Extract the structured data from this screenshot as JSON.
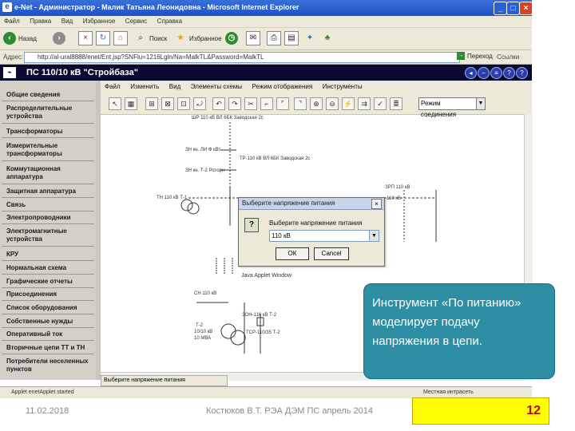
{
  "browser": {
    "title": "e-Net - Администратор - Малик Татьяна Леонидовна - Microsoft Internet Explorer",
    "menu": [
      "Файл",
      "Правка",
      "Вид",
      "Избранное",
      "Сервис",
      "Справка"
    ],
    "toolbar": {
      "back": "Назад",
      "search": "Поиск",
      "favorites": "Избранное"
    },
    "address_label": "Адрес:",
    "address": "http://al-ural8888/enet/Ent.jsp?SNFlu=1216Lgln/Na=MalkTL&Password=MalkTL",
    "go": "Переход",
    "links": "Ссылки",
    "status_left": "Applet enetApplet started",
    "status_right": "Местная интрасеть"
  },
  "app": {
    "title": "ПС 110/10 кВ \"Стройбаза\"",
    "sidebar": [
      "Общие сведения",
      "Распределительные устройства",
      "Трансформаторы",
      "Измерительные трансформаторы",
      "Коммутационная аппаратура",
      "Защитная аппаратура",
      "Связь",
      "Электропроводники",
      "Электромагнитные устройства",
      "КРУ",
      "Нормальная схема",
      "Графические отчеты",
      "Присоединения",
      "Список оборудования",
      "Собственные нужды",
      "Оперативный ток",
      "Вторичные цепи ТТ и ТН",
      "Потребители неселенных пунктов"
    ],
    "editor_menu": [
      "Файл",
      "Изменить",
      "Вид",
      "Элементы схемы",
      "Режим отображения",
      "Инструменты"
    ],
    "mode": "Режим соединения",
    "editor_status": "Выберите напряжение питания"
  },
  "dialog": {
    "title": "Выберите напряжение питания",
    "prompt": "Выберите напряжение питания",
    "value": "110 кВ",
    "ok": "ОК",
    "cancel": "Cancel",
    "java_label": "Java Applet Window"
  },
  "schematic": {
    "labels": [
      "ШР 110 кВ ВЛ 6БК Заводская 2с",
      "ЗН кн. ЛИ Ф кВт",
      "ТР-110 кВ ВЛ 6БК Заводская 2с",
      "ЗН кн. Т-2 Роторн",
      "ТН 110 кВ Т-1",
      "ЗРП 110 кВ",
      "110 кВ",
      "СН 110 кВ",
      "ЗОН-110 кВ Т-2",
      "Т-2",
      "10/10 кВ",
      "10 МВА",
      "ТСР-110/35 Т-2"
    ]
  },
  "callout": "Инструмент «По питанию» моделирует подачу напряжения в цепи.",
  "slide": {
    "date": "11.02.2018",
    "author": "Костюков В.Т. РЭА ДЭМ ПС апрель 2014",
    "page": "12"
  }
}
